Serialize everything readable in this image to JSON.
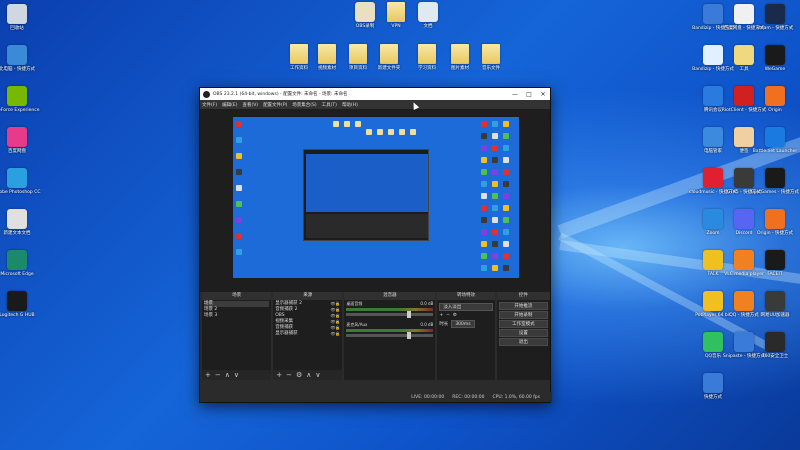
{
  "desktop": {
    "left_icons": [
      {
        "label": "回收站",
        "color": "#cfd8e0"
      },
      {
        "label": "此电脑 - 快捷方式",
        "color": "#3a8ad8"
      },
      {
        "label": "GeForce Experience",
        "color": "#76b900"
      },
      {
        "label": "百度网盘",
        "color": "#e83a8a"
      },
      {
        "label": "Adobe Photoshop CC",
        "color": "#2aa0e0"
      },
      {
        "label": "新建文本文档",
        "color": "#e0e0e0"
      },
      {
        "label": "Microsoft Edge",
        "color": "#1a8a6a"
      },
      {
        "label": "Logitech G HUB",
        "color": "#1a1a1a"
      }
    ],
    "top_icons": [
      {
        "label": "OBS录制",
        "color": "#e8e0c0"
      },
      {
        "label": "VPN",
        "color": "#f0d880"
      },
      {
        "label": "文档",
        "color": "#e0e8f0"
      },
      {
        "label": "工作资料",
        "color": "#f0d880"
      },
      {
        "label": "视频素材",
        "color": "#f0d880"
      },
      {
        "label": "项目资料",
        "color": "#f0d880"
      },
      {
        "label": "新建文件夹",
        "color": "#f0d880"
      },
      {
        "label": "学习资料",
        "color": "#f0d880"
      },
      {
        "label": "图片素材",
        "color": "#f0d880"
      },
      {
        "label": "音乐文件",
        "color": "#f0d880"
      }
    ],
    "right_icons": [
      {
        "label": "Bandizip - 快捷方式",
        "color": "#3a7ad8"
      },
      {
        "label": "百度网盘 - 快捷方式",
        "color": "#f0f0f0"
      },
      {
        "label": "steam - 快捷方式",
        "color": "#1a2a4a"
      },
      {
        "label": "Bandizip - 快捷方式",
        "color": "#e0f0ff"
      },
      {
        "label": "工具",
        "color": "#f0d880"
      },
      {
        "label": "WeGame",
        "color": "#1a1a1a"
      },
      {
        "label": "腾讯会议",
        "color": "#2a7ae0"
      },
      {
        "label": "RiotClient - 快捷方式",
        "color": "#d02020"
      },
      {
        "label": "Origin",
        "color": "#f07020"
      },
      {
        "label": "电脑管家",
        "color": "#3a8ae0"
      },
      {
        "label": "便签",
        "color": "#f0d0a0"
      },
      {
        "label": "Battle.net Launcher",
        "color": "#1a7ae0"
      },
      {
        "label": "cloudmusic - 快捷方式",
        "color": "#e02030"
      },
      {
        "label": "GTA5 - 快捷方式",
        "color": "#3a3a3a"
      },
      {
        "label": "EpicGames - 快捷方式",
        "color": "#1a1a1a"
      },
      {
        "label": "Zoom",
        "color": "#2a8ae0"
      },
      {
        "label": "Discord",
        "color": "#5865f2"
      },
      {
        "label": "Origin - 快捷方式",
        "color": "#f07020"
      },
      {
        "label": "TALK",
        "color": "#f0c020"
      },
      {
        "label": "VLC media player",
        "color": "#f08020"
      },
      {
        "label": "FACEIT",
        "color": "#1a1a1a"
      },
      {
        "label": "PotPlayer 64 bit",
        "color": "#f0c020"
      },
      {
        "label": "QQ - 快捷方式",
        "color": "#f08020"
      },
      {
        "label": "网易UU加速器",
        "color": "#3a3a3a"
      },
      {
        "label": "QQ音乐",
        "color": "#30c060"
      },
      {
        "label": "Snipaste - 快捷方式",
        "color": "#3a7ad8"
      },
      {
        "label": "360安全卫士",
        "color": "#2a2a2a"
      },
      {
        "label": "快捷方式",
        "color": "#3a7ad8"
      }
    ]
  },
  "obs": {
    "title": "OBS 23.2.1 (64-bit, windows) - 配置文件: 未命名 - 场景: 未命名",
    "window_buttons": [
      "—",
      "□",
      "✕"
    ],
    "menu": [
      "文件(F)",
      "编辑(E)",
      "查看(V)",
      "配置文件(P)",
      "场景集合(S)",
      "工具(T)",
      "帮助(H)"
    ],
    "docks": {
      "scenes": {
        "header": "场景",
        "items": [
          "场景",
          "场景 2",
          "场景 3"
        ],
        "selected": 0
      },
      "sources": {
        "header": "来源",
        "items": [
          "显示器捕获 2",
          "音频捕获 2",
          "OBS",
          "视频采集",
          "音频捕获",
          "显示器捕获"
        ]
      },
      "mixer": {
        "header": "混音器",
        "channels": [
          {
            "name": "桌面音频",
            "level": "0.0 dB"
          },
          {
            "name": "麦克风/Aux",
            "level": "0.0 dB"
          }
        ]
      },
      "transitions": {
        "header": "转场特效",
        "type": "淡入淡出",
        "duration_label": "时长",
        "duration": "300ms"
      },
      "controls": {
        "header": "控件",
        "buttons": [
          "开始推流",
          "开始录制",
          "工作室模式",
          "设置",
          "退出"
        ]
      }
    },
    "statusbar": {
      "live": "LIVE: 00:00:00",
      "rec": "REC: 00:00:00",
      "cpu": "CPU: 1.0%, 60.00 fps"
    }
  }
}
